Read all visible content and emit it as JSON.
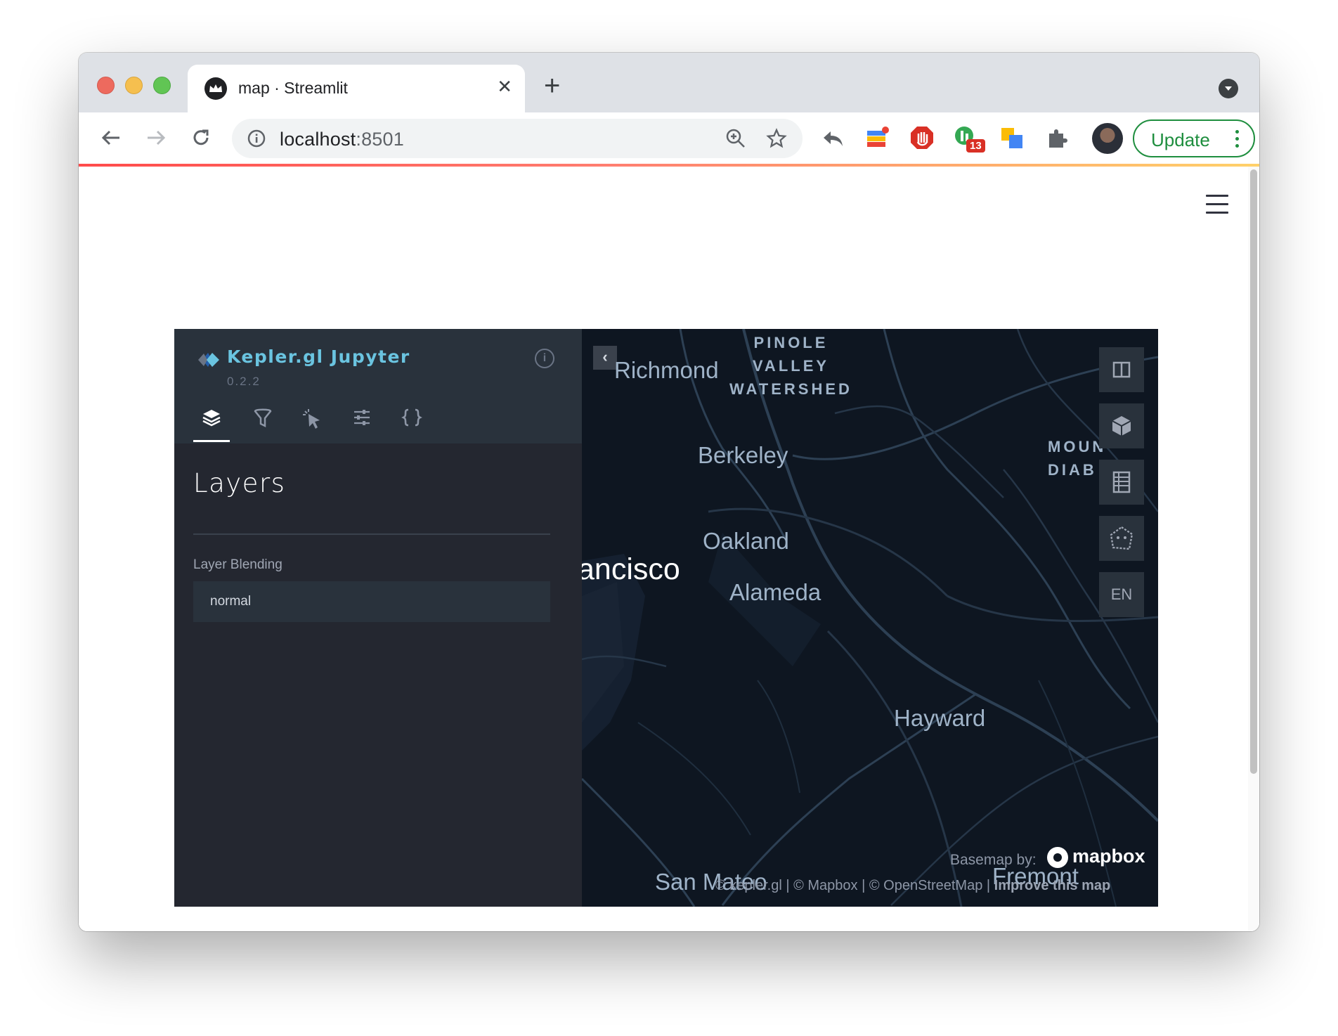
{
  "browser": {
    "tab_title": "map · Streamlit",
    "tab_close": "✕",
    "new_tab": "+",
    "url_host": "localhost",
    "url_port": ":8501",
    "extension_badge": "13",
    "update_label": "Update"
  },
  "kepler": {
    "app_name": "Kepler.gl Jupyter",
    "version": "0.2.2",
    "info": "i",
    "tabs": [
      "layers",
      "filters",
      "interactions",
      "map-style",
      "export"
    ],
    "panel_title": "Layers",
    "layer_blending_label": "Layer Blending",
    "layer_blending_value": "normal"
  },
  "map": {
    "collapse": "‹",
    "labels": {
      "richmond": "Richmond",
      "pinole": "PINOLE\nVALLEY\nWATERSHED",
      "berkeley": "Berkeley",
      "oakland": "Oakland",
      "sanfrancisco": "ancisco",
      "alameda": "Alameda",
      "hayward": "Hayward",
      "sanmateo": "San Mateo",
      "fremont": "Fremont",
      "mountdiablo": "MOUN\nDIAB"
    },
    "controls": {
      "split": "split-map-icon",
      "view3d": "3d-view-icon",
      "legend": "legend-icon",
      "draw": "draw-polygon-icon",
      "locale": "EN"
    },
    "basemap_label": "Basemap by:",
    "mapbox": "mapbox",
    "attribution_text": "© kepler.gl | © Mapbox | © OpenStreetMap | ",
    "attribution_link": "Improve this map"
  },
  "colors": {
    "streamlit_accent": "#ff4b4b",
    "kepler_accent": "#6ac4e0",
    "panel_bg": "#242730",
    "map_bg": "#0e1621",
    "update_green": "#1e8e3e"
  }
}
